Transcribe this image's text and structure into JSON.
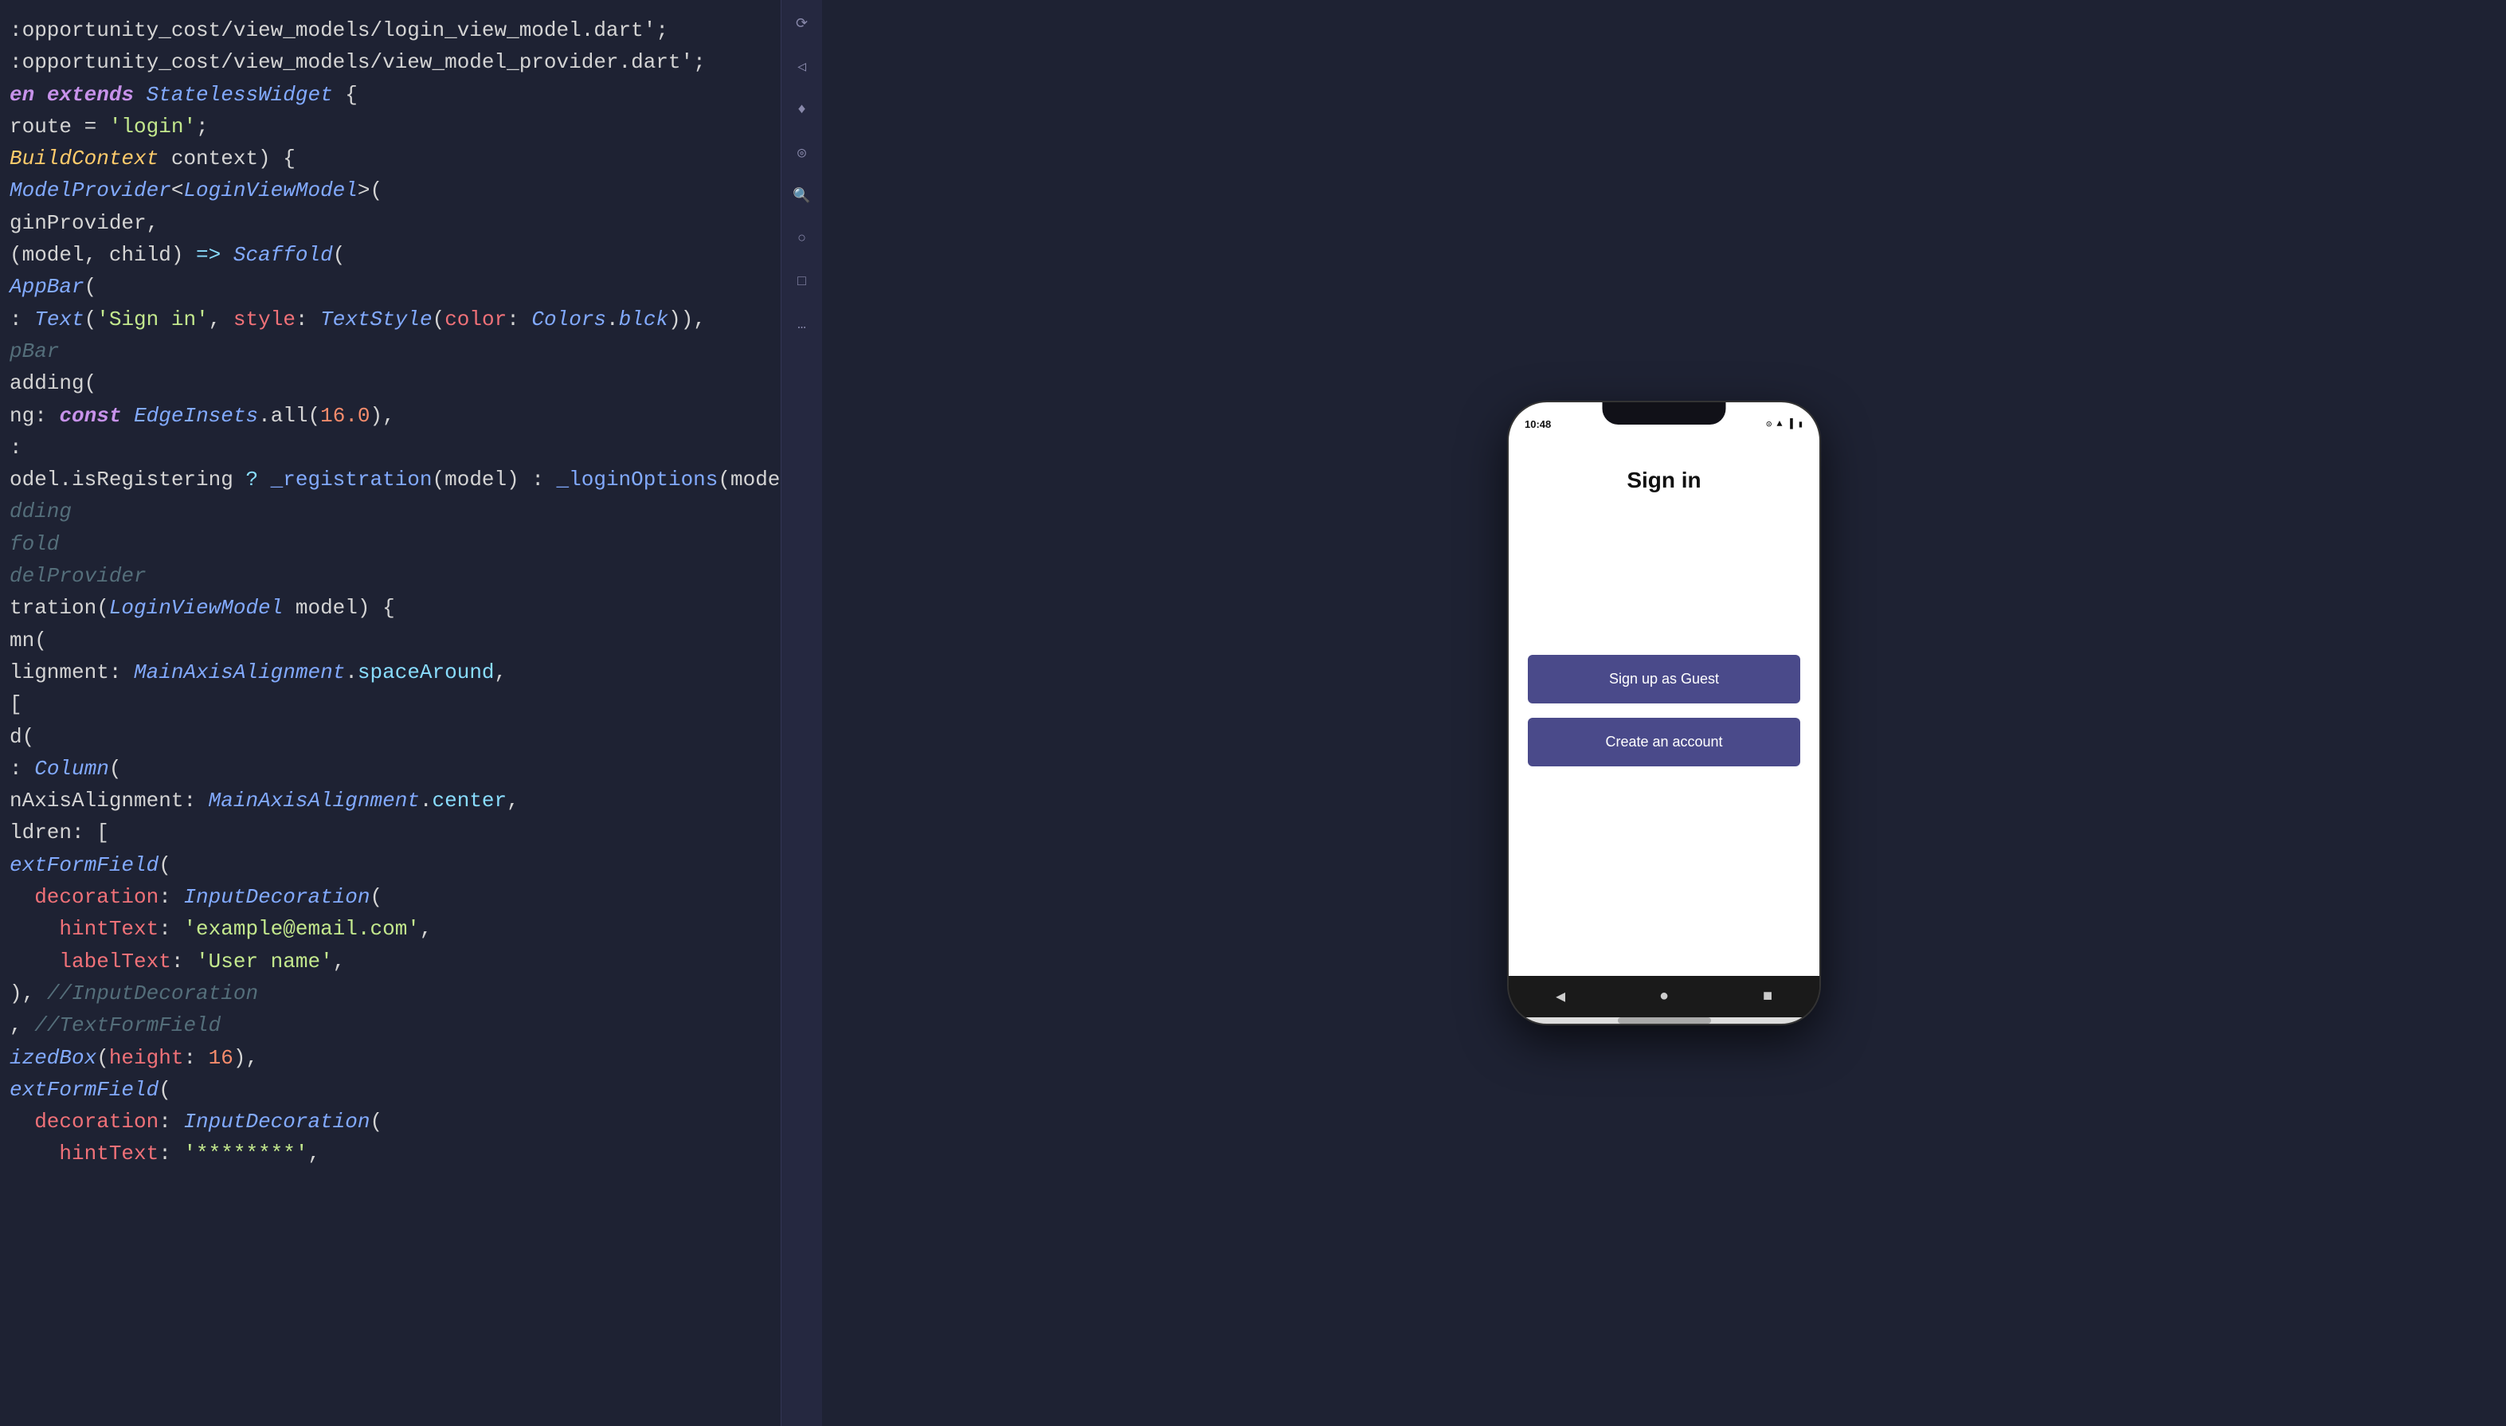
{
  "editor": {
    "lines": [
      {
        "id": "l1",
        "tokens": [
          {
            "t": ":opportunity_cost/view_models/login_view_model.dart';",
            "c": "plain"
          }
        ]
      },
      {
        "id": "l2",
        "tokens": [
          {
            "t": ":opportunity_cost/view_models/view_model_provider.dart';",
            "c": "plain"
          }
        ]
      },
      {
        "id": "l3",
        "tokens": [
          {
            "t": "",
            "c": "plain"
          }
        ]
      },
      {
        "id": "l4",
        "tokens": [
          {
            "t": "en ",
            "c": "kw"
          },
          {
            "t": "extends ",
            "c": "kw"
          },
          {
            "t": "StatelessWidget",
            "c": "cls"
          },
          {
            "t": " {",
            "c": "plain"
          }
        ]
      },
      {
        "id": "l5",
        "tokens": [
          {
            "t": "route = ",
            "c": "plain"
          },
          {
            "t": "'login'",
            "c": "str"
          },
          {
            "t": ";",
            "c": "plain"
          }
        ]
      },
      {
        "id": "l6",
        "tokens": [
          {
            "t": "",
            "c": "plain"
          }
        ]
      },
      {
        "id": "l7",
        "tokens": [
          {
            "t": "",
            "c": "plain"
          }
        ]
      },
      {
        "id": "l8",
        "tokens": [
          {
            "t": "BuildContext",
            "c": "type"
          },
          {
            "t": " context) {",
            "c": "plain"
          }
        ]
      },
      {
        "id": "l9",
        "tokens": [
          {
            "t": "ModelProvider",
            "c": "cls"
          },
          {
            "t": "<",
            "c": "plain"
          },
          {
            "t": "LoginViewModel",
            "c": "cls"
          },
          {
            "t": ">(",
            "c": "plain"
          }
        ]
      },
      {
        "id": "l10",
        "tokens": [
          {
            "t": "ginProvider,",
            "c": "plain"
          }
        ]
      },
      {
        "id": "l11",
        "tokens": [
          {
            "t": "(model, child) ",
            "c": "plain"
          },
          {
            "t": "=> ",
            "c": "acc"
          },
          {
            "t": "Scaffold",
            "c": "cls"
          },
          {
            "t": "(",
            "c": "plain"
          }
        ]
      },
      {
        "id": "l12",
        "tokens": [
          {
            "t": "AppBar",
            "c": "cls"
          },
          {
            "t": "(",
            "c": "plain"
          }
        ]
      },
      {
        "id": "l13",
        "tokens": [
          {
            "t": ": ",
            "c": "plain"
          },
          {
            "t": "Text",
            "c": "cls"
          },
          {
            "t": "(",
            "c": "plain"
          },
          {
            "t": "'Sign in'",
            "c": "str"
          },
          {
            "t": ", ",
            "c": "plain"
          },
          {
            "t": "style",
            "c": "prop"
          },
          {
            "t": ": ",
            "c": "plain"
          },
          {
            "t": "TextStyle",
            "c": "cls"
          },
          {
            "t": "(",
            "c": "plain"
          },
          {
            "t": "color",
            "c": "prop"
          },
          {
            "t": ": ",
            "c": "plain"
          },
          {
            "t": "Colors",
            "c": "cls"
          },
          {
            "t": ".",
            "c": "plain"
          },
          {
            "t": "bl",
            "c": "cls"
          },
          {
            "t": "ck",
            "c": "cls"
          },
          {
            "t": "))",
            "c": "plain"
          },
          {
            "t": ",",
            "c": "plain"
          }
        ]
      },
      {
        "id": "l14",
        "tokens": [
          {
            "t": "pBar",
            "c": "cm"
          }
        ]
      },
      {
        "id": "l15",
        "tokens": [
          {
            "t": "adding(",
            "c": "plain"
          }
        ]
      },
      {
        "id": "l16",
        "tokens": [
          {
            "t": "ng",
            "c": "plain"
          },
          {
            "t": ": ",
            "c": "plain"
          },
          {
            "t": "const ",
            "c": "kw"
          },
          {
            "t": "EdgeInsets",
            "c": "cls"
          },
          {
            "t": ".all(",
            "c": "plain"
          },
          {
            "t": "16.0",
            "c": "num"
          },
          {
            "t": "),",
            "c": "plain"
          }
        ]
      },
      {
        "id": "l17",
        "tokens": [
          {
            "t": ":",
            "c": "plain"
          }
        ]
      },
      {
        "id": "l18",
        "tokens": [
          {
            "t": "odel.isRegistering ",
            "c": "plain"
          },
          {
            "t": "? ",
            "c": "acc"
          },
          {
            "t": "_registration",
            "c": "fn"
          },
          {
            "t": "(model) : ",
            "c": "plain"
          },
          {
            "t": "_loginOptions",
            "c": "fn"
          },
          {
            "t": "(model),",
            "c": "plain"
          }
        ]
      },
      {
        "id": "l19",
        "tokens": [
          {
            "t": "dding",
            "c": "cm"
          }
        ]
      },
      {
        "id": "l20",
        "tokens": [
          {
            "t": "fold",
            "c": "cm"
          }
        ]
      },
      {
        "id": "l21",
        "tokens": [
          {
            "t": "delProvider",
            "c": "cm"
          }
        ]
      },
      {
        "id": "l22",
        "tokens": [
          {
            "t": "",
            "c": "plain"
          }
        ]
      },
      {
        "id": "l23",
        "tokens": [
          {
            "t": "",
            "c": "plain"
          }
        ]
      },
      {
        "id": "l24",
        "tokens": [
          {
            "t": "tration(",
            "c": "plain"
          },
          {
            "t": "LoginViewModel",
            "c": "cls"
          },
          {
            "t": " model) {",
            "c": "plain"
          }
        ]
      },
      {
        "id": "l25",
        "tokens": [
          {
            "t": "mn(",
            "c": "plain"
          }
        ]
      },
      {
        "id": "l26",
        "tokens": [
          {
            "t": "lignment",
            "c": "plain"
          },
          {
            "t": ": ",
            "c": "plain"
          },
          {
            "t": "MainAxisAlignment",
            "c": "cls"
          },
          {
            "t": ".",
            "c": "plain"
          },
          {
            "t": "spaceAround",
            "c": "acc"
          },
          {
            "t": ",",
            "c": "plain"
          }
        ]
      },
      {
        "id": "l27",
        "tokens": [
          {
            "t": "[",
            "c": "plain"
          }
        ]
      },
      {
        "id": "l28",
        "tokens": [
          {
            "t": "d(",
            "c": "plain"
          }
        ]
      },
      {
        "id": "l29",
        "tokens": [
          {
            "t": ": ",
            "c": "plain"
          },
          {
            "t": "Column",
            "c": "cls"
          },
          {
            "t": "(",
            "c": "plain"
          }
        ]
      },
      {
        "id": "l30",
        "tokens": [
          {
            "t": "nAxisAlignment",
            "c": "plain"
          },
          {
            "t": ": ",
            "c": "plain"
          },
          {
            "t": "MainAxisAlignment",
            "c": "cls"
          },
          {
            "t": ".",
            "c": "plain"
          },
          {
            "t": "center",
            "c": "acc"
          },
          {
            "t": ",",
            "c": "plain"
          }
        ]
      },
      {
        "id": "l31",
        "tokens": [
          {
            "t": "ldren",
            "c": "plain"
          },
          {
            "t": ": [",
            "c": "plain"
          }
        ]
      },
      {
        "id": "l32",
        "tokens": [
          {
            "t": "extFormField",
            "c": "cls"
          },
          {
            "t": "(",
            "c": "plain"
          }
        ]
      },
      {
        "id": "l33",
        "tokens": [
          {
            "t": "  decoration",
            "c": "prop"
          },
          {
            "t": ": ",
            "c": "plain"
          },
          {
            "t": "InputDecoration",
            "c": "cls"
          },
          {
            "t": "(",
            "c": "plain"
          }
        ]
      },
      {
        "id": "l34",
        "tokens": [
          {
            "t": "    hintText",
            "c": "prop"
          },
          {
            "t": ": ",
            "c": "plain"
          },
          {
            "t": "'example@email.com'",
            "c": "str"
          },
          {
            "t": ",",
            "c": "plain"
          }
        ]
      },
      {
        "id": "l35",
        "tokens": [
          {
            "t": "    labelText",
            "c": "prop"
          },
          {
            "t": ": ",
            "c": "plain"
          },
          {
            "t": "'User name'",
            "c": "str"
          },
          {
            "t": ",",
            "c": "plain"
          }
        ]
      },
      {
        "id": "l36",
        "tokens": [
          {
            "t": "), ",
            "c": "plain"
          },
          {
            "t": "//InputDecoration",
            "c": "cm"
          }
        ]
      },
      {
        "id": "l37",
        "tokens": [
          {
            "t": ", ",
            "c": "plain"
          },
          {
            "t": "//TextFormField",
            "c": "cm"
          }
        ]
      },
      {
        "id": "l38",
        "tokens": [
          {
            "t": "izedBox",
            "c": "cls"
          },
          {
            "t": "(",
            "c": "plain"
          },
          {
            "t": "height",
            "c": "prop"
          },
          {
            "t": ": ",
            "c": "plain"
          },
          {
            "t": "16",
            "c": "num"
          },
          {
            "t": "),",
            "c": "plain"
          }
        ]
      },
      {
        "id": "l39",
        "tokens": [
          {
            "t": "extFormField",
            "c": "cls"
          },
          {
            "t": "(",
            "c": "plain"
          }
        ]
      },
      {
        "id": "l40",
        "tokens": [
          {
            "t": "  decoration",
            "c": "prop"
          },
          {
            "t": ": ",
            "c": "plain"
          },
          {
            "t": "InputDecoration",
            "c": "cls"
          },
          {
            "t": "(",
            "c": "plain"
          }
        ]
      },
      {
        "id": "l41",
        "tokens": [
          {
            "t": "    hintText",
            "c": "prop"
          },
          {
            "t": ": ",
            "c": "plain"
          },
          {
            "t": "'********'",
            "c": "str"
          },
          {
            "t": ",",
            "c": "plain"
          }
        ]
      }
    ]
  },
  "tools": [
    "⟳",
    "◁",
    "♦",
    "◎",
    "🔍",
    "○",
    "□",
    "…"
  ],
  "phone": {
    "status_time": "10:48",
    "title": "Sign in",
    "btn_guest": "Sign up as Guest",
    "btn_account": "Create an account",
    "nav_back": "◀",
    "nav_home": "●",
    "nav_square": "■"
  }
}
